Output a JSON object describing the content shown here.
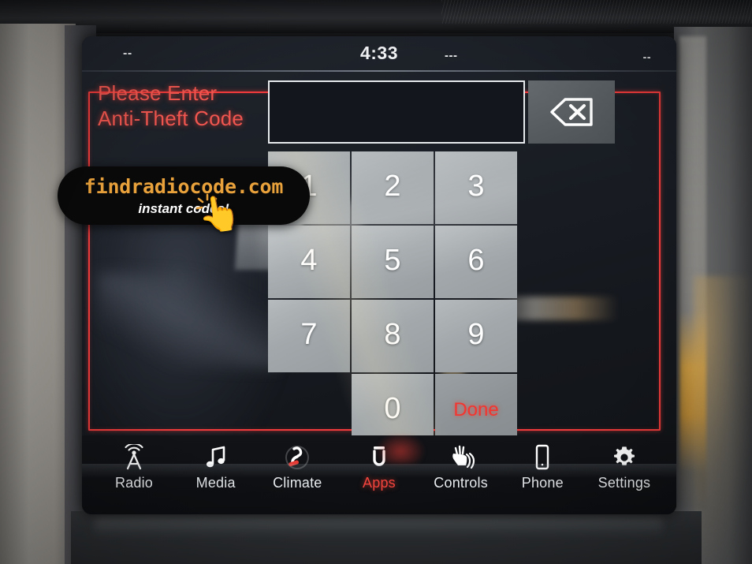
{
  "status_bar": {
    "left_indicator": "--",
    "clock": "4:33",
    "mid_indicator": "---",
    "right_indicator": "--"
  },
  "dialog": {
    "prompt_line1": "Please Enter",
    "prompt_line2": "Anti-Theft Code",
    "code_value": "",
    "code_placeholder": "",
    "backspace_icon": "backspace-delete-icon",
    "accent_color": "#ef3b3b"
  },
  "keypad": {
    "keys": [
      {
        "label": "1",
        "name": "key-1",
        "type": "digit"
      },
      {
        "label": "2",
        "name": "key-2",
        "type": "digit"
      },
      {
        "label": "3",
        "name": "key-3",
        "type": "digit"
      },
      {
        "label": "4",
        "name": "key-4",
        "type": "digit"
      },
      {
        "label": "5",
        "name": "key-5",
        "type": "digit"
      },
      {
        "label": "6",
        "name": "key-6",
        "type": "digit"
      },
      {
        "label": "7",
        "name": "key-7",
        "type": "digit"
      },
      {
        "label": "8",
        "name": "key-8",
        "type": "digit"
      },
      {
        "label": "9",
        "name": "key-9",
        "type": "digit"
      },
      {
        "label": "",
        "name": "key-blank",
        "type": "blank"
      },
      {
        "label": "0",
        "name": "key-0",
        "type": "digit"
      },
      {
        "label": "Done",
        "name": "key-done",
        "type": "done"
      }
    ],
    "done_color": "#f4342e"
  },
  "nav_bar": {
    "items": [
      {
        "label": "Radio",
        "icon": "radio-antenna-icon",
        "active": false
      },
      {
        "label": "Media",
        "icon": "music-note-icon",
        "active": false
      },
      {
        "label": "Climate",
        "icon": "climate-seat-icon",
        "active": false
      },
      {
        "label": "Apps",
        "icon": "uconnect-apps-icon",
        "active": true
      },
      {
        "label": "Controls",
        "icon": "controls-hand-icon",
        "active": false
      },
      {
        "label": "Phone",
        "icon": "phone-icon",
        "active": false
      },
      {
        "label": "Settings",
        "icon": "gear-icon",
        "active": false
      }
    ],
    "active_color": "#f2443c"
  },
  "watermark": {
    "domain": "findradiocode.com",
    "tagline": "instant codes!",
    "hand_icon": "tapping-hand-icon",
    "domain_color": "#e9a13b"
  }
}
